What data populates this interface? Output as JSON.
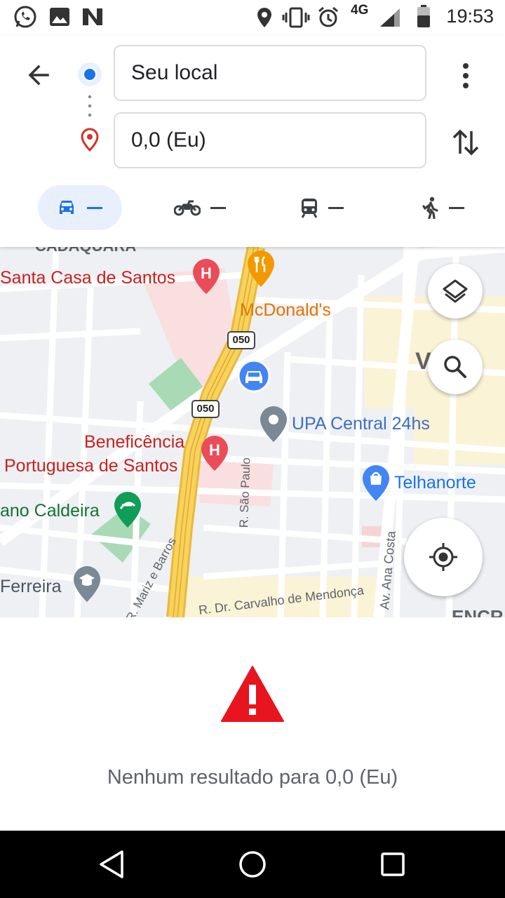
{
  "status_bar": {
    "time": "19:53",
    "network": "4G",
    "left_icons": [
      "whatsapp-icon",
      "image-icon",
      "n-icon"
    ],
    "right_icons": [
      "location-icon",
      "vibrate-icon",
      "alarm-icon",
      "signal-icon",
      "battery-icon"
    ]
  },
  "directions": {
    "origin": "Seu local",
    "destination": "0,0 (Eu)",
    "modes": [
      {
        "name": "car",
        "value": "—",
        "selected": true
      },
      {
        "name": "motorcycle",
        "value": "—",
        "selected": false
      },
      {
        "name": "transit",
        "value": "—",
        "selected": false
      },
      {
        "name": "walk",
        "value": "—",
        "selected": false
      }
    ]
  },
  "map": {
    "labels": {
      "hospital1": "Santa Casa de Santos",
      "mcdonalds": "McDonald's",
      "upa": "UPA Central 24hs",
      "beneficencia1": "Beneficência",
      "beneficencia2": "Portuguesa de Santos",
      "telhanorte": "Telhanorte",
      "caldeira": "ano Caldeira",
      "ferreira": "Ferreira",
      "vm": "V MA",
      "top": "CADAQUARA",
      "bottom_right": "ENCR"
    },
    "streets": {
      "sao_paulo": "R. São Paulo",
      "ana_costa": "Av. Ana Costa",
      "carvalho": "R. Dr. Carvalho de Mendonça",
      "mariz": "R. Mariz e Barros"
    },
    "shield": "050"
  },
  "result": {
    "message": "Nenhum resultado para 0,0 (Eu)"
  },
  "colors": {
    "accent": "#1a73e8",
    "error": "#e8141e",
    "highway": "#f6c343"
  }
}
